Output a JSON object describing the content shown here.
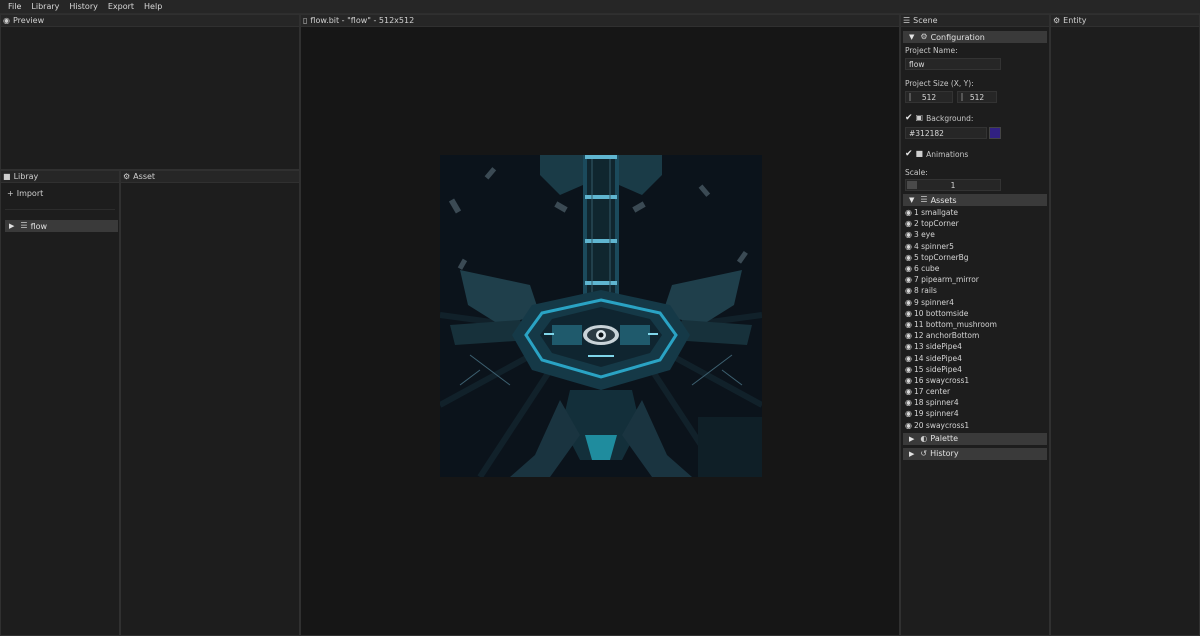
{
  "menu": [
    "File",
    "Library",
    "History",
    "Export",
    "Help"
  ],
  "panels": {
    "preview": {
      "title": "Preview"
    },
    "library": {
      "title": "Libray",
      "import_label": "Import",
      "items": [
        {
          "label": "flow"
        }
      ]
    },
    "asset": {
      "title": "Asset"
    },
    "viewport": {
      "title": "flow.bit - \"flow\" - 512x512"
    },
    "scene": {
      "title": "Scene"
    },
    "entity": {
      "title": "Entity"
    }
  },
  "configuration": {
    "header": "Configuration",
    "project_name_label": "Project Name:",
    "project_name_value": "flow",
    "project_size_label": "Project Size (X, Y):",
    "size_x": "512",
    "size_y": "512",
    "background_label": "Background:",
    "background_value": "#312182",
    "background_color": "#312182",
    "animations_label": "Animations",
    "scale_label": "Scale:",
    "scale_value": "1"
  },
  "assets": {
    "header": "Assets",
    "items": [
      "1 smallgate",
      "2 topCorner",
      "3 eye",
      "4 spinner5",
      "5 topCornerBg",
      "6 cube",
      "7 pipearm_mirror",
      "8 rails",
      "9 spinner4",
      "10 bottomside",
      "11 bottom_mushroom",
      "12 anchorBottom",
      "13 sidePipe4",
      "14 sidePipe4",
      "15 sidePipe4",
      "16 swaycross1",
      "17 center",
      "18 spinner4",
      "19 spinner4",
      "20 swaycross1"
    ]
  },
  "sections": {
    "palette": "Palette",
    "history": "History"
  },
  "icons": {
    "preview": "eye-icon",
    "library": "book-icon",
    "asset": "gear-icon",
    "viewport": "file-icon",
    "scene": "list-icon",
    "entity": "gear-icon",
    "import": "plus-icon",
    "layers": "layers-icon",
    "image": "image-icon",
    "camera": "video-camera-icon",
    "palette": "palette-icon",
    "history": "history-icon",
    "check": "check-icon",
    "visible": "eye-icon"
  }
}
